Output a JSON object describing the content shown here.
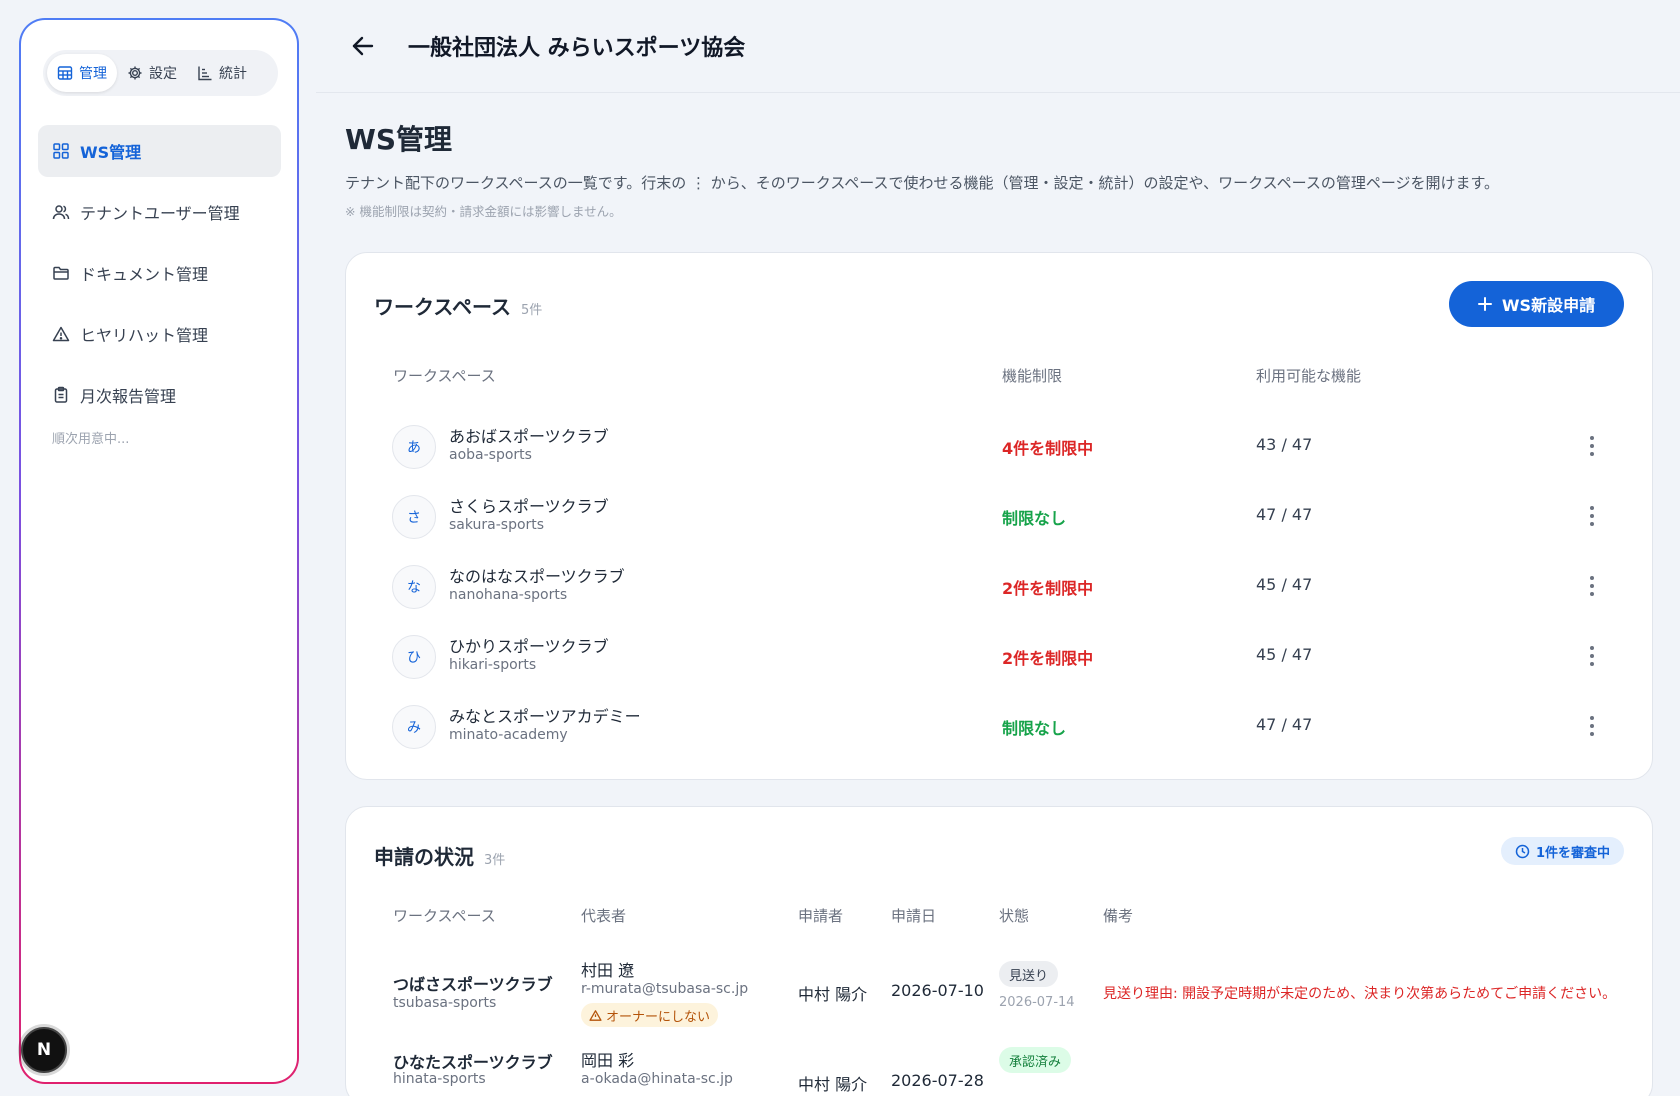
{
  "sidebar": {
    "segments": [
      {
        "label": "管理",
        "icon": "table-icon",
        "active": true
      },
      {
        "label": "設定",
        "icon": "gear-icon",
        "active": false
      },
      {
        "label": "統計",
        "icon": "chart-icon",
        "active": false
      }
    ],
    "nav": [
      {
        "label": "WS管理",
        "icon": "grid-icon",
        "active": true
      },
      {
        "label": "テナントユーザー管理",
        "icon": "users-icon",
        "active": false
      },
      {
        "label": "ドキュメント管理",
        "icon": "folder-icon",
        "active": false
      },
      {
        "label": "ヒヤリハット管理",
        "icon": "warning-icon",
        "active": false
      },
      {
        "label": "月次報告管理",
        "icon": "clipboard-icon",
        "active": false
      }
    ],
    "note": "順次用意中...",
    "fab_label": "N"
  },
  "header": {
    "title": "一般社団法人 みらいスポーツ協会"
  },
  "page": {
    "title": "WS管理",
    "description": "テナント配下のワークスペースの一覧です。行末の ⋮ から、そのワークスペースで使わせる機能（管理・設定・統計）の設定や、ワークスペースの管理ページを開けます。",
    "note": "※ 機能制限は契約・請求金額には影響しません。"
  },
  "workspaces": {
    "title": "ワークスペース",
    "count": "5件",
    "new_button": "WS新設申請",
    "columns": [
      "ワークスペース",
      "機能制限",
      "利用可能な機能"
    ],
    "rows": [
      {
        "initial": "あ",
        "name": "あおばスポーツクラブ",
        "slug": "aoba-sports",
        "limit": "4件を制限中",
        "limit_color": "#dc2626",
        "available": "43 / 47"
      },
      {
        "initial": "さ",
        "name": "さくらスポーツクラブ",
        "slug": "sakura-sports",
        "limit": "制限なし",
        "limit_color": "#16a34a",
        "available": "47 / 47"
      },
      {
        "initial": "な",
        "name": "なのはなスポーツクラブ",
        "slug": "nanohana-sports",
        "limit": "2件を制限中",
        "limit_color": "#dc2626",
        "available": "45 / 47"
      },
      {
        "initial": "ひ",
        "name": "ひかりスポーツクラブ",
        "slug": "hikari-sports",
        "limit": "2件を制限中",
        "limit_color": "#dc2626",
        "available": "45 / 47"
      },
      {
        "initial": "み",
        "name": "みなとスポーツアカデミー",
        "slug": "minato-academy",
        "limit": "制限なし",
        "limit_color": "#16a34a",
        "available": "47 / 47"
      }
    ]
  },
  "applications": {
    "title": "申請の状況",
    "count": "3件",
    "pending_badge": "1件を審査中",
    "columns": [
      "ワークスペース",
      "代表者",
      "申請者",
      "申請日",
      "状態",
      "備考"
    ],
    "rows": [
      {
        "name": "つばさスポーツクラブ",
        "slug": "tsubasa-sports",
        "rep": "村田 遼",
        "email": "r-murata@tsubasa-sc.jp",
        "warning": "オーナーにしない",
        "applicant": "中村 陽介",
        "date": "2026-07-10",
        "status": "見送り",
        "status_date": "2026-07-14",
        "note": "見送り理由: 開設予定時期が未定のため、決まり次第あらためてご申請ください。"
      },
      {
        "name": "ひなたスポーツクラブ",
        "slug": "hinata-sports",
        "rep": "岡田 彩",
        "email": "a-okada@hinata-sc.jp",
        "applicant": "中村 陽介",
        "date": "2026-07-28",
        "status": "承認済み"
      }
    ]
  }
}
